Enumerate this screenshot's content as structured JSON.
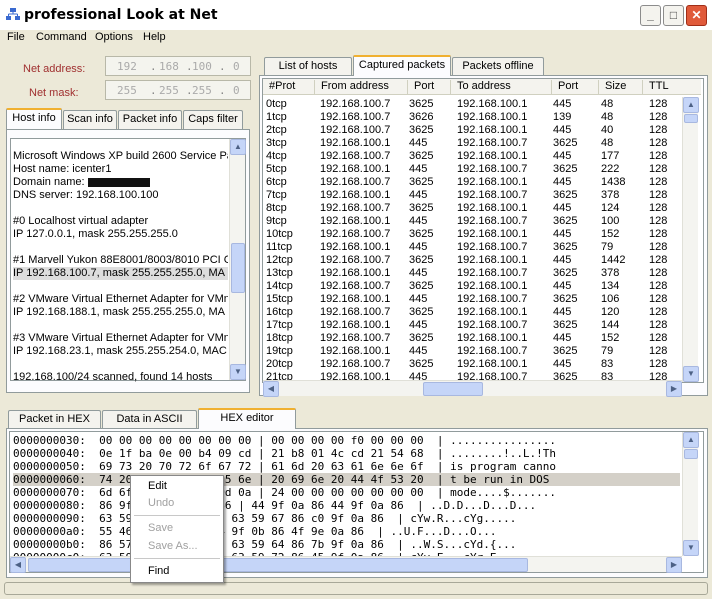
{
  "window": {
    "title": "professional Look at Net",
    "min": "_",
    "max": "□",
    "close": "✕"
  },
  "menu": [
    "File",
    "Command",
    "Options",
    "Help"
  ],
  "network": {
    "address_label": "Net address:",
    "mask_label": "Net mask:",
    "address": [
      "192",
      "168",
      "100",
      "0"
    ],
    "mask": [
      "255",
      "255",
      "255",
      "0"
    ]
  },
  "left_tabs": [
    "Host info",
    "Scan info",
    "Packet info",
    "Caps filter"
  ],
  "host_info": [
    "Microsoft Windows XP build 2600 Service Pac",
    "Host name: icenter1",
    "Domain name: ",
    "DNS server: 192.168.100.100",
    "",
    "#0 Localhost virtual adapter",
    "IP 127.0.0.1, mask 255.255.255.0",
    "",
    "#1 Marvell Yukon 88E8001/8003/8010 PCI G",
    "IP 192.168.100.7, mask 255.255.255.0, MA",
    "",
    "#2 VMware Virtual Ethernet Adapter for VMn",
    "IP 192.168.188.1, mask 255.255.255.0, MA",
    "",
    "#3 VMware Virtual Ethernet Adapter for VMn",
    "IP 192.168.23.1, mask 255.255.254.0, MAC",
    "",
    "192.168.100/24 scanned, found 14 hosts"
  ],
  "right_tabs": [
    "List of hosts",
    "Captured packets",
    "Packets offline"
  ],
  "packet_columns": [
    "#Prot",
    "From address",
    "Port",
    "To address",
    "Port",
    "Size",
    "TTL"
  ],
  "packets": [
    [
      "0tcp",
      "192.168.100.7",
      "3625",
      "192.168.100.1",
      "445",
      "48",
      "128"
    ],
    [
      "1tcp",
      "192.168.100.7",
      "3626",
      "192.168.100.1",
      "139",
      "48",
      "128"
    ],
    [
      "2tcp",
      "192.168.100.7",
      "3625",
      "192.168.100.1",
      "445",
      "40",
      "128"
    ],
    [
      "3tcp",
      "192.168.100.1",
      "445",
      "192.168.100.7",
      "3625",
      "48",
      "128"
    ],
    [
      "4tcp",
      "192.168.100.7",
      "3625",
      "192.168.100.1",
      "445",
      "177",
      "128"
    ],
    [
      "5tcp",
      "192.168.100.1",
      "445",
      "192.168.100.7",
      "3625",
      "222",
      "128"
    ],
    [
      "6tcp",
      "192.168.100.7",
      "3625",
      "192.168.100.1",
      "445",
      "1438",
      "128"
    ],
    [
      "7tcp",
      "192.168.100.1",
      "445",
      "192.168.100.7",
      "3625",
      "378",
      "128"
    ],
    [
      "8tcp",
      "192.168.100.7",
      "3625",
      "192.168.100.1",
      "445",
      "124",
      "128"
    ],
    [
      "9tcp",
      "192.168.100.1",
      "445",
      "192.168.100.7",
      "3625",
      "100",
      "128"
    ],
    [
      "10tcp",
      "192.168.100.7",
      "3625",
      "192.168.100.1",
      "445",
      "152",
      "128"
    ],
    [
      "11tcp",
      "192.168.100.1",
      "445",
      "192.168.100.7",
      "3625",
      "79",
      "128"
    ],
    [
      "12tcp",
      "192.168.100.7",
      "3625",
      "192.168.100.1",
      "445",
      "1442",
      "128"
    ],
    [
      "13tcp",
      "192.168.100.1",
      "445",
      "192.168.100.7",
      "3625",
      "378",
      "128"
    ],
    [
      "14tcp",
      "192.168.100.7",
      "3625",
      "192.168.100.1",
      "445",
      "134",
      "128"
    ],
    [
      "15tcp",
      "192.168.100.1",
      "445",
      "192.168.100.7",
      "3625",
      "106",
      "128"
    ],
    [
      "16tcp",
      "192.168.100.7",
      "3625",
      "192.168.100.1",
      "445",
      "120",
      "128"
    ],
    [
      "17tcp",
      "192.168.100.1",
      "445",
      "192.168.100.7",
      "3625",
      "144",
      "128"
    ],
    [
      "18tcp",
      "192.168.100.7",
      "3625",
      "192.168.100.1",
      "445",
      "152",
      "128"
    ],
    [
      "19tcp",
      "192.168.100.1",
      "445",
      "192.168.100.7",
      "3625",
      "79",
      "128"
    ],
    [
      "20tcp",
      "192.168.100.7",
      "3625",
      "192.168.100.1",
      "445",
      "83",
      "128"
    ],
    [
      "21tcp",
      "192.168.100.1",
      "445",
      "192.168.100.7",
      "3625",
      "83",
      "128"
    ]
  ],
  "bottom_tabs": [
    "Packet in HEX",
    "Data in ASCII",
    "HEX editor"
  ],
  "hex_lines": [
    "0000000030:  00 00 00 00 00 00 00 00 | 00 00 00 00 f0 00 00 00  | ................",
    "0000000040:  0e 1f ba 0e 00 b4 09 cd | 21 b8 01 4c cd 21 54 68  | ........!..L.!Th",
    "0000000050:  69 73 20 70 72 6f 67 72 | 61 6d 20 63 61 6e 6e 6f  | is program canno",
    "0000000060:  74 20 62 65 20 72 75 6e | 20 69 6e 20 44 4f 53 20  | t be run in DOS ",
    "0000000070:  6d 6f 64 65 2e 0d 0d 0a | 24 00 00 00 00 00 00 00  | mode....$.......",
    "0000000080:  86 9f 0a 86 9f 0a 86 | 44 9f 0a 86 44 9f 0a 86  | ..D.D...D...D...",
    "0000000090:  63 59 57 9f 0a 86 | 63 59 67 86 c0 9f 0a 86  | cYw.R...cYg.....",
    "00000000a0:  55 46 9f 0a 86 | 44 9f 0b 86 4f 9e 0a 86  | ..U.F...D...O...",
    "00000000b0:  86 57 53 9f 0a 86 | 63 59 64 86 7b 9f 0a 86  | ..W.S...cYd.{...",
    "00000000c0:  63 59 45 9f 0a 86 | 63 59 72 86 45 9f 0a 86  | cYv.E...cYr.E..."
  ],
  "context_menu": {
    "edit": "Edit",
    "undo": "Undo",
    "save": "Save",
    "save_as": "Save As...",
    "find": "Find"
  }
}
